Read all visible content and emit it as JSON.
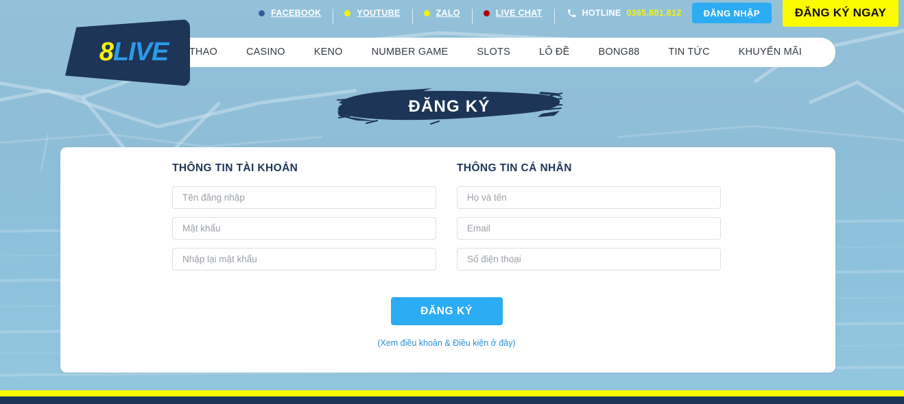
{
  "brand": {
    "logo_part1": "8",
    "logo_part2": "LIVE"
  },
  "colors": {
    "navy": "#1d3557",
    "accent_blue": "#2cacf2",
    "yellow": "#fbfb00",
    "page_bg": "#8fc0da"
  },
  "topbar": {
    "socials": [
      {
        "label": "FACEBOOK",
        "dot_color": "#3b5998",
        "icon": "facebook-dot-icon"
      },
      {
        "label": "YOUTUBE",
        "dot_color": "#f2f20d",
        "icon": "youtube-dot-icon"
      },
      {
        "label": "ZALO",
        "dot_color": "#f2f20d",
        "icon": "zalo-dot-icon"
      },
      {
        "label": "LIVE CHAT",
        "dot_color": "#b00000",
        "icon": "live-chat-dot-icon"
      }
    ],
    "hotline_label": "HOTLINE",
    "hotline_number": "0365.881.812",
    "phone_icon": "phone-icon",
    "login_label": "ĐĂNG NHẬP",
    "register_now_label": "ĐĂNG KÝ NGAY"
  },
  "nav": {
    "items": [
      {
        "label": "THỂ THAO"
      },
      {
        "label": "CASINO"
      },
      {
        "label": "KENO"
      },
      {
        "label": "NUMBER GAME"
      },
      {
        "label": "SLOTS"
      },
      {
        "label": "LÔ ĐỀ"
      },
      {
        "label": "BONG88"
      },
      {
        "label": "TIN TỨC"
      },
      {
        "label": "KHUYẾN MÃI"
      }
    ]
  },
  "banner": {
    "title": "ĐĂNG KÝ"
  },
  "form": {
    "account_section": {
      "title": "THÔNG TIN TÀI KHOẢN",
      "fields": [
        {
          "name": "username",
          "placeholder": "Tên đăng nhập",
          "value": "",
          "type": "text"
        },
        {
          "name": "password",
          "placeholder": "Mật khẩu",
          "value": "",
          "type": "password"
        },
        {
          "name": "confirm-password",
          "placeholder": "Nhập lại mật khẩu",
          "value": "",
          "type": "password"
        }
      ]
    },
    "personal_section": {
      "title": "THÔNG TIN CÁ NHÂN",
      "fields": [
        {
          "name": "fullname",
          "placeholder": "Họ và tên",
          "value": "",
          "type": "text"
        },
        {
          "name": "email",
          "placeholder": "Email",
          "value": "",
          "type": "text"
        },
        {
          "name": "phone",
          "placeholder": "Số điện thoại",
          "value": "",
          "type": "text"
        }
      ]
    },
    "submit_label": "ĐĂNG KÝ",
    "terms_label": "(Xem điều khoản & Điều kiện ở đây)"
  }
}
